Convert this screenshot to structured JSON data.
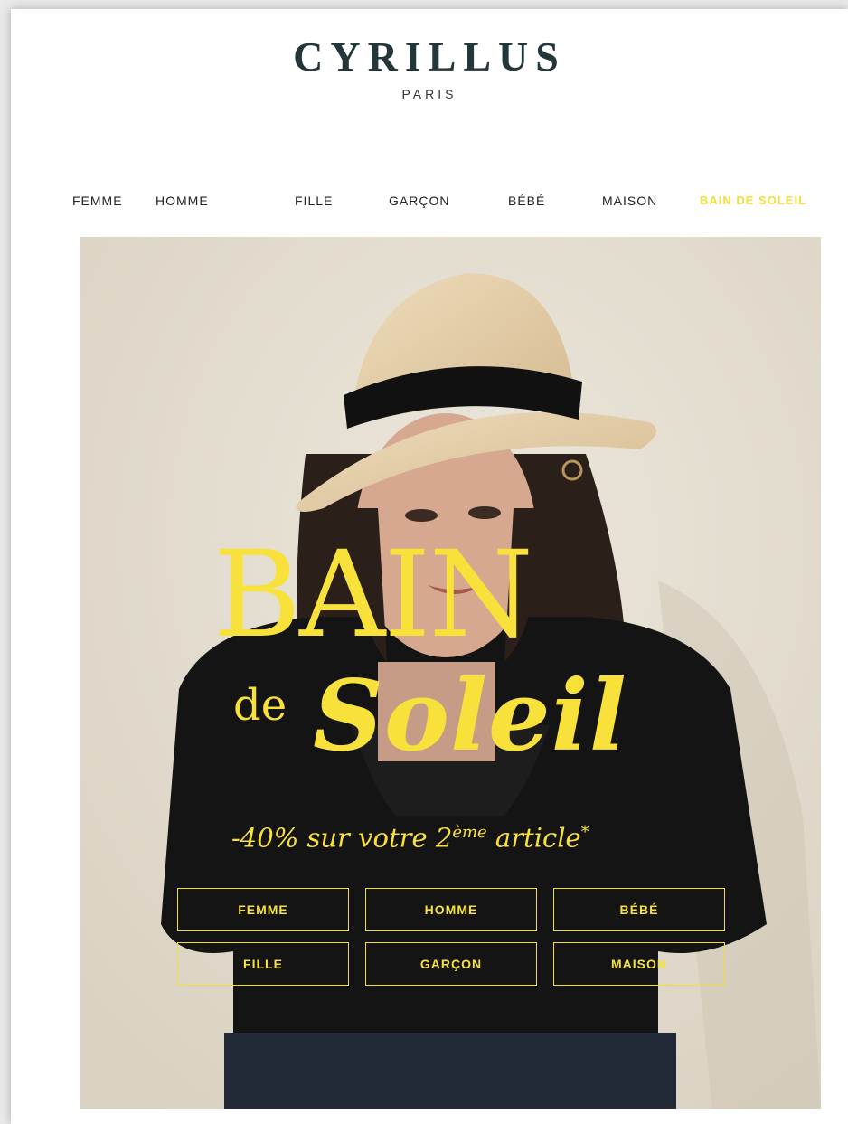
{
  "brand": {
    "name": "CYRILLUS",
    "subtitle": "PARIS"
  },
  "nav": {
    "items": [
      "FEMME",
      "HOMME",
      "FILLE",
      "GARÇON",
      "BÉBÉ",
      "MAISON",
      "BAIN DE SOLEIL"
    ],
    "active_color": "#f5de3a"
  },
  "hero": {
    "line1": "BAIN",
    "line2_small": "de",
    "line2_big": "Soleil",
    "offer_prefix": "-40% sur votre 2",
    "offer_sup": "ème",
    "offer_suffix": " article",
    "offer_mark": "*",
    "accent_color": "#f7e13a",
    "buttons": [
      "FEMME",
      "HOMME",
      "BÉBÉ",
      "FILLE",
      "GARÇON",
      "MAISON"
    ]
  }
}
